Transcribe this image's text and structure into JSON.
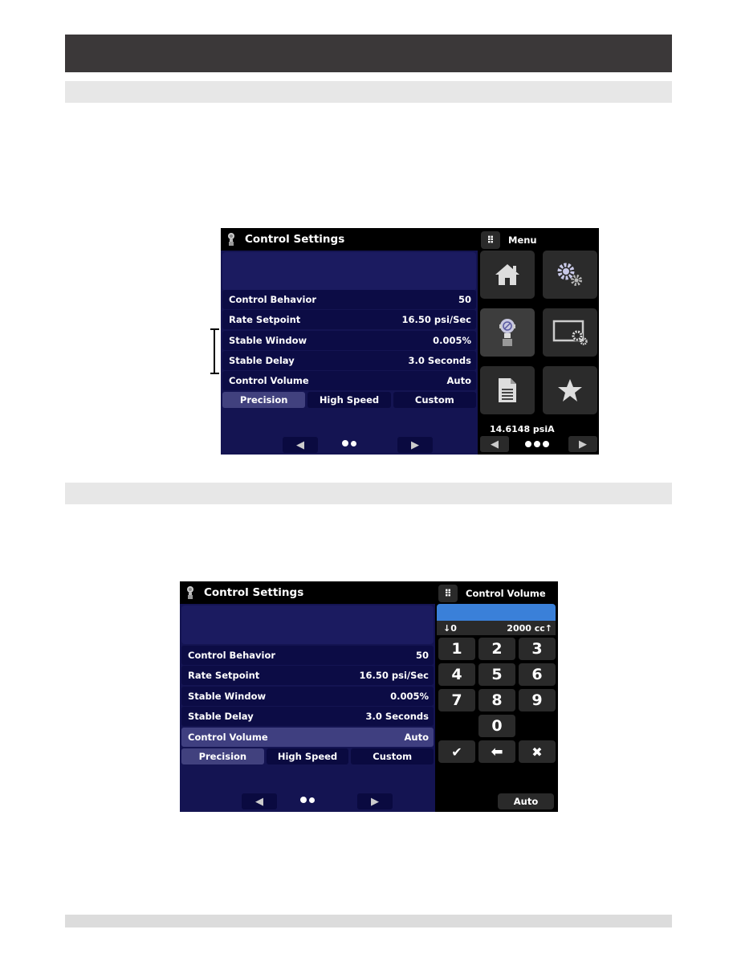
{
  "page": {
    "header_title": "",
    "section1_title": "",
    "section2_title": "",
    "footer_text": ""
  },
  "screen1": {
    "title": "Control Settings",
    "rows": [
      {
        "label": "Control Behavior",
        "value": "50"
      },
      {
        "label": "Rate Setpoint",
        "value": "16.50 psi/Sec"
      },
      {
        "label": "Stable Window",
        "value": "0.005%"
      },
      {
        "label": "Stable Delay",
        "value": "3.0 Seconds"
      },
      {
        "label": "Control Volume",
        "value": "Auto"
      }
    ],
    "tabs": [
      "Precision",
      "High Speed",
      "Custom"
    ],
    "active_tab": "Precision",
    "pager_dots": 2,
    "menu": {
      "title": "Menu",
      "tiles": [
        {
          "icon": "home-icon"
        },
        {
          "icon": "gears-icon"
        },
        {
          "icon": "controller-icon",
          "active": true
        },
        {
          "icon": "display-settings-icon"
        },
        {
          "icon": "document-icon"
        },
        {
          "icon": "star-icon"
        }
      ],
      "readout": "14.6148 psiA",
      "pager_dots": 3
    }
  },
  "screen2": {
    "title": "Control Settings",
    "rows": [
      {
        "label": "Control Behavior",
        "value": "50"
      },
      {
        "label": "Rate Setpoint",
        "value": "16.50 psi/Sec"
      },
      {
        "label": "Stable Window",
        "value": "0.005%"
      },
      {
        "label": "Stable Delay",
        "value": "3.0 Seconds"
      },
      {
        "label": "Control Volume",
        "value": "Auto",
        "selected": true
      }
    ],
    "tabs": [
      "Precision",
      "High Speed",
      "Custom"
    ],
    "active_tab": "Precision",
    "pager_dots": 2,
    "keypad": {
      "title": "Control Volume",
      "entry_value": "",
      "range_min": "↓0",
      "range_max": "2000 cc↑",
      "keys": [
        "1",
        "2",
        "3",
        "4",
        "5",
        "6",
        "7",
        "8",
        "9",
        "0"
      ],
      "enter_key": "✔",
      "backspace_key": "🡸",
      "cancel_key": "✖",
      "auto_label": "Auto"
    }
  },
  "colors": {
    "header_bar": "#3b3839",
    "section_bar": "#e7e7e7",
    "screen_bg": "#141452",
    "row_bg": "#0c0c45",
    "active_tab": "#41417e",
    "entry_blue": "#3a80d9"
  }
}
